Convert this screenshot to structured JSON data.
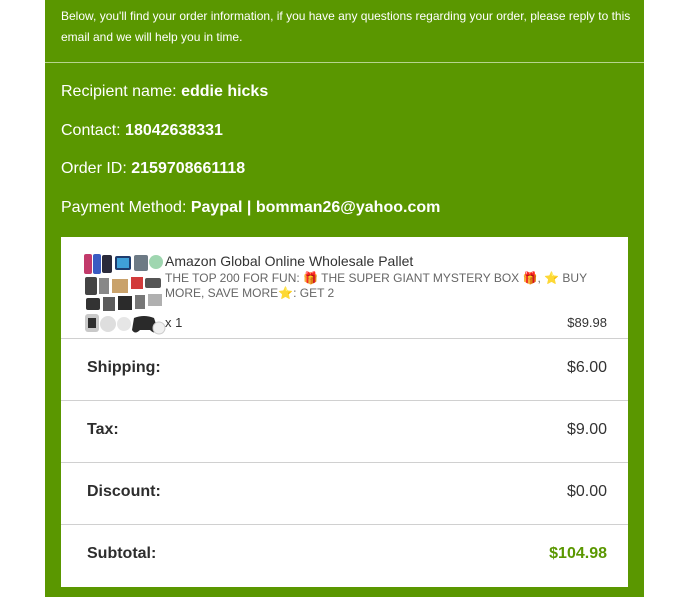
{
  "intro": "Below, you'll find your order information, if you have any questions regarding your order, please reply to this email and we will help you in time.",
  "recipient": {
    "label": "Recipient name:",
    "value": "eddie hicks"
  },
  "contact": {
    "label": "Contact:",
    "value": "18042638331"
  },
  "order": {
    "label": "Order ID:",
    "value": "2159708661118"
  },
  "payment": {
    "label": "Payment Method:",
    "value": "Paypal | bomman26@yahoo.com"
  },
  "product": {
    "title": "Amazon Global Online Wholesale Pallet",
    "desc_part1": "THE TOP 200 FOR FUN: ",
    "desc_part2": " THE SUPER GIANT MYSTERY BOX ",
    "desc_part3": ", ",
    "desc_part4": " BUY MORE, SAVE MORE",
    "desc_part5": ": GET 2",
    "gift_glyph": "🎁",
    "star_glyph": "⭐",
    "qty": "x 1",
    "price": "$89.98",
    "image_icon": "product-collage"
  },
  "summary": [
    {
      "label": "Shipping:",
      "amount": "$6.00"
    },
    {
      "label": "Tax:",
      "amount": "$9.00"
    },
    {
      "label": "Discount:",
      "amount": "$0.00"
    },
    {
      "label": "Subtotal:",
      "amount": "$104.98"
    }
  ],
  "colors": {
    "brand_green": "#5a9700",
    "divider": "#b7d48d"
  }
}
